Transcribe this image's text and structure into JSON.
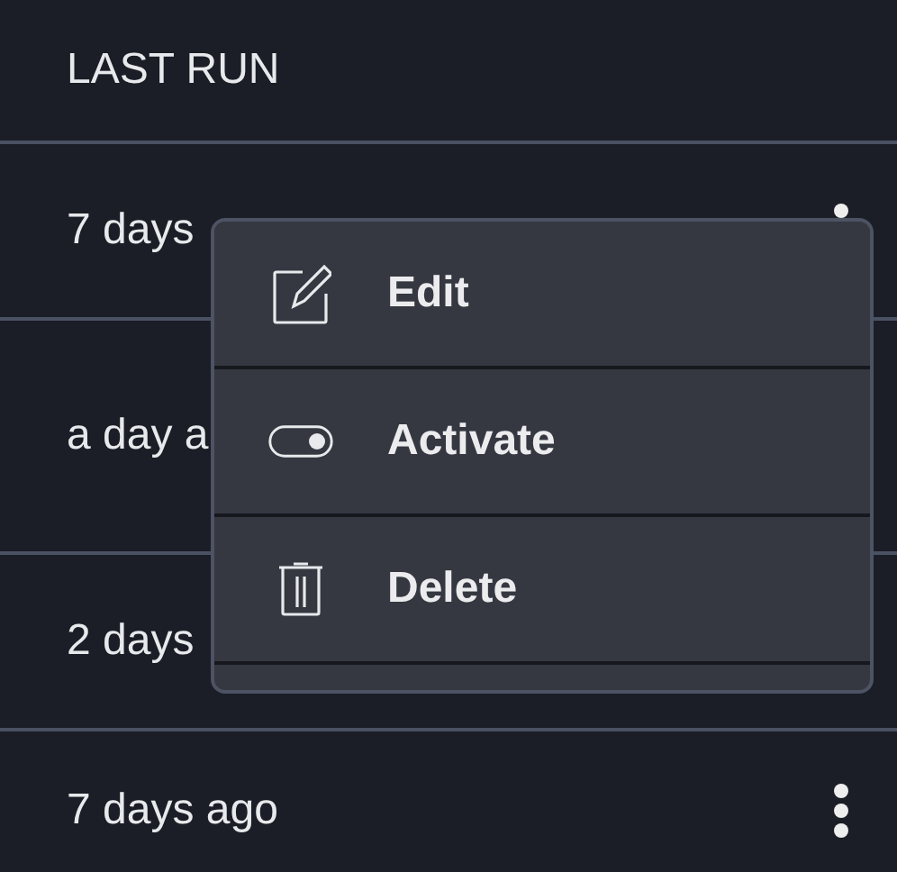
{
  "table": {
    "columns": [
      "LAST RUN"
    ],
    "rows": [
      {
        "last_run": "7 days",
        "menu_button": true
      },
      {
        "last_run": "a day a",
        "menu_button": false
      },
      {
        "last_run": "2 days",
        "menu_button": false
      },
      {
        "last_run": "7 days ago",
        "menu_button": true
      }
    ]
  },
  "context_menu": {
    "items": [
      {
        "kind": "edit",
        "label": "Edit"
      },
      {
        "kind": "toggle",
        "label": "Activate"
      },
      {
        "kind": "delete",
        "label": "Delete"
      }
    ]
  }
}
